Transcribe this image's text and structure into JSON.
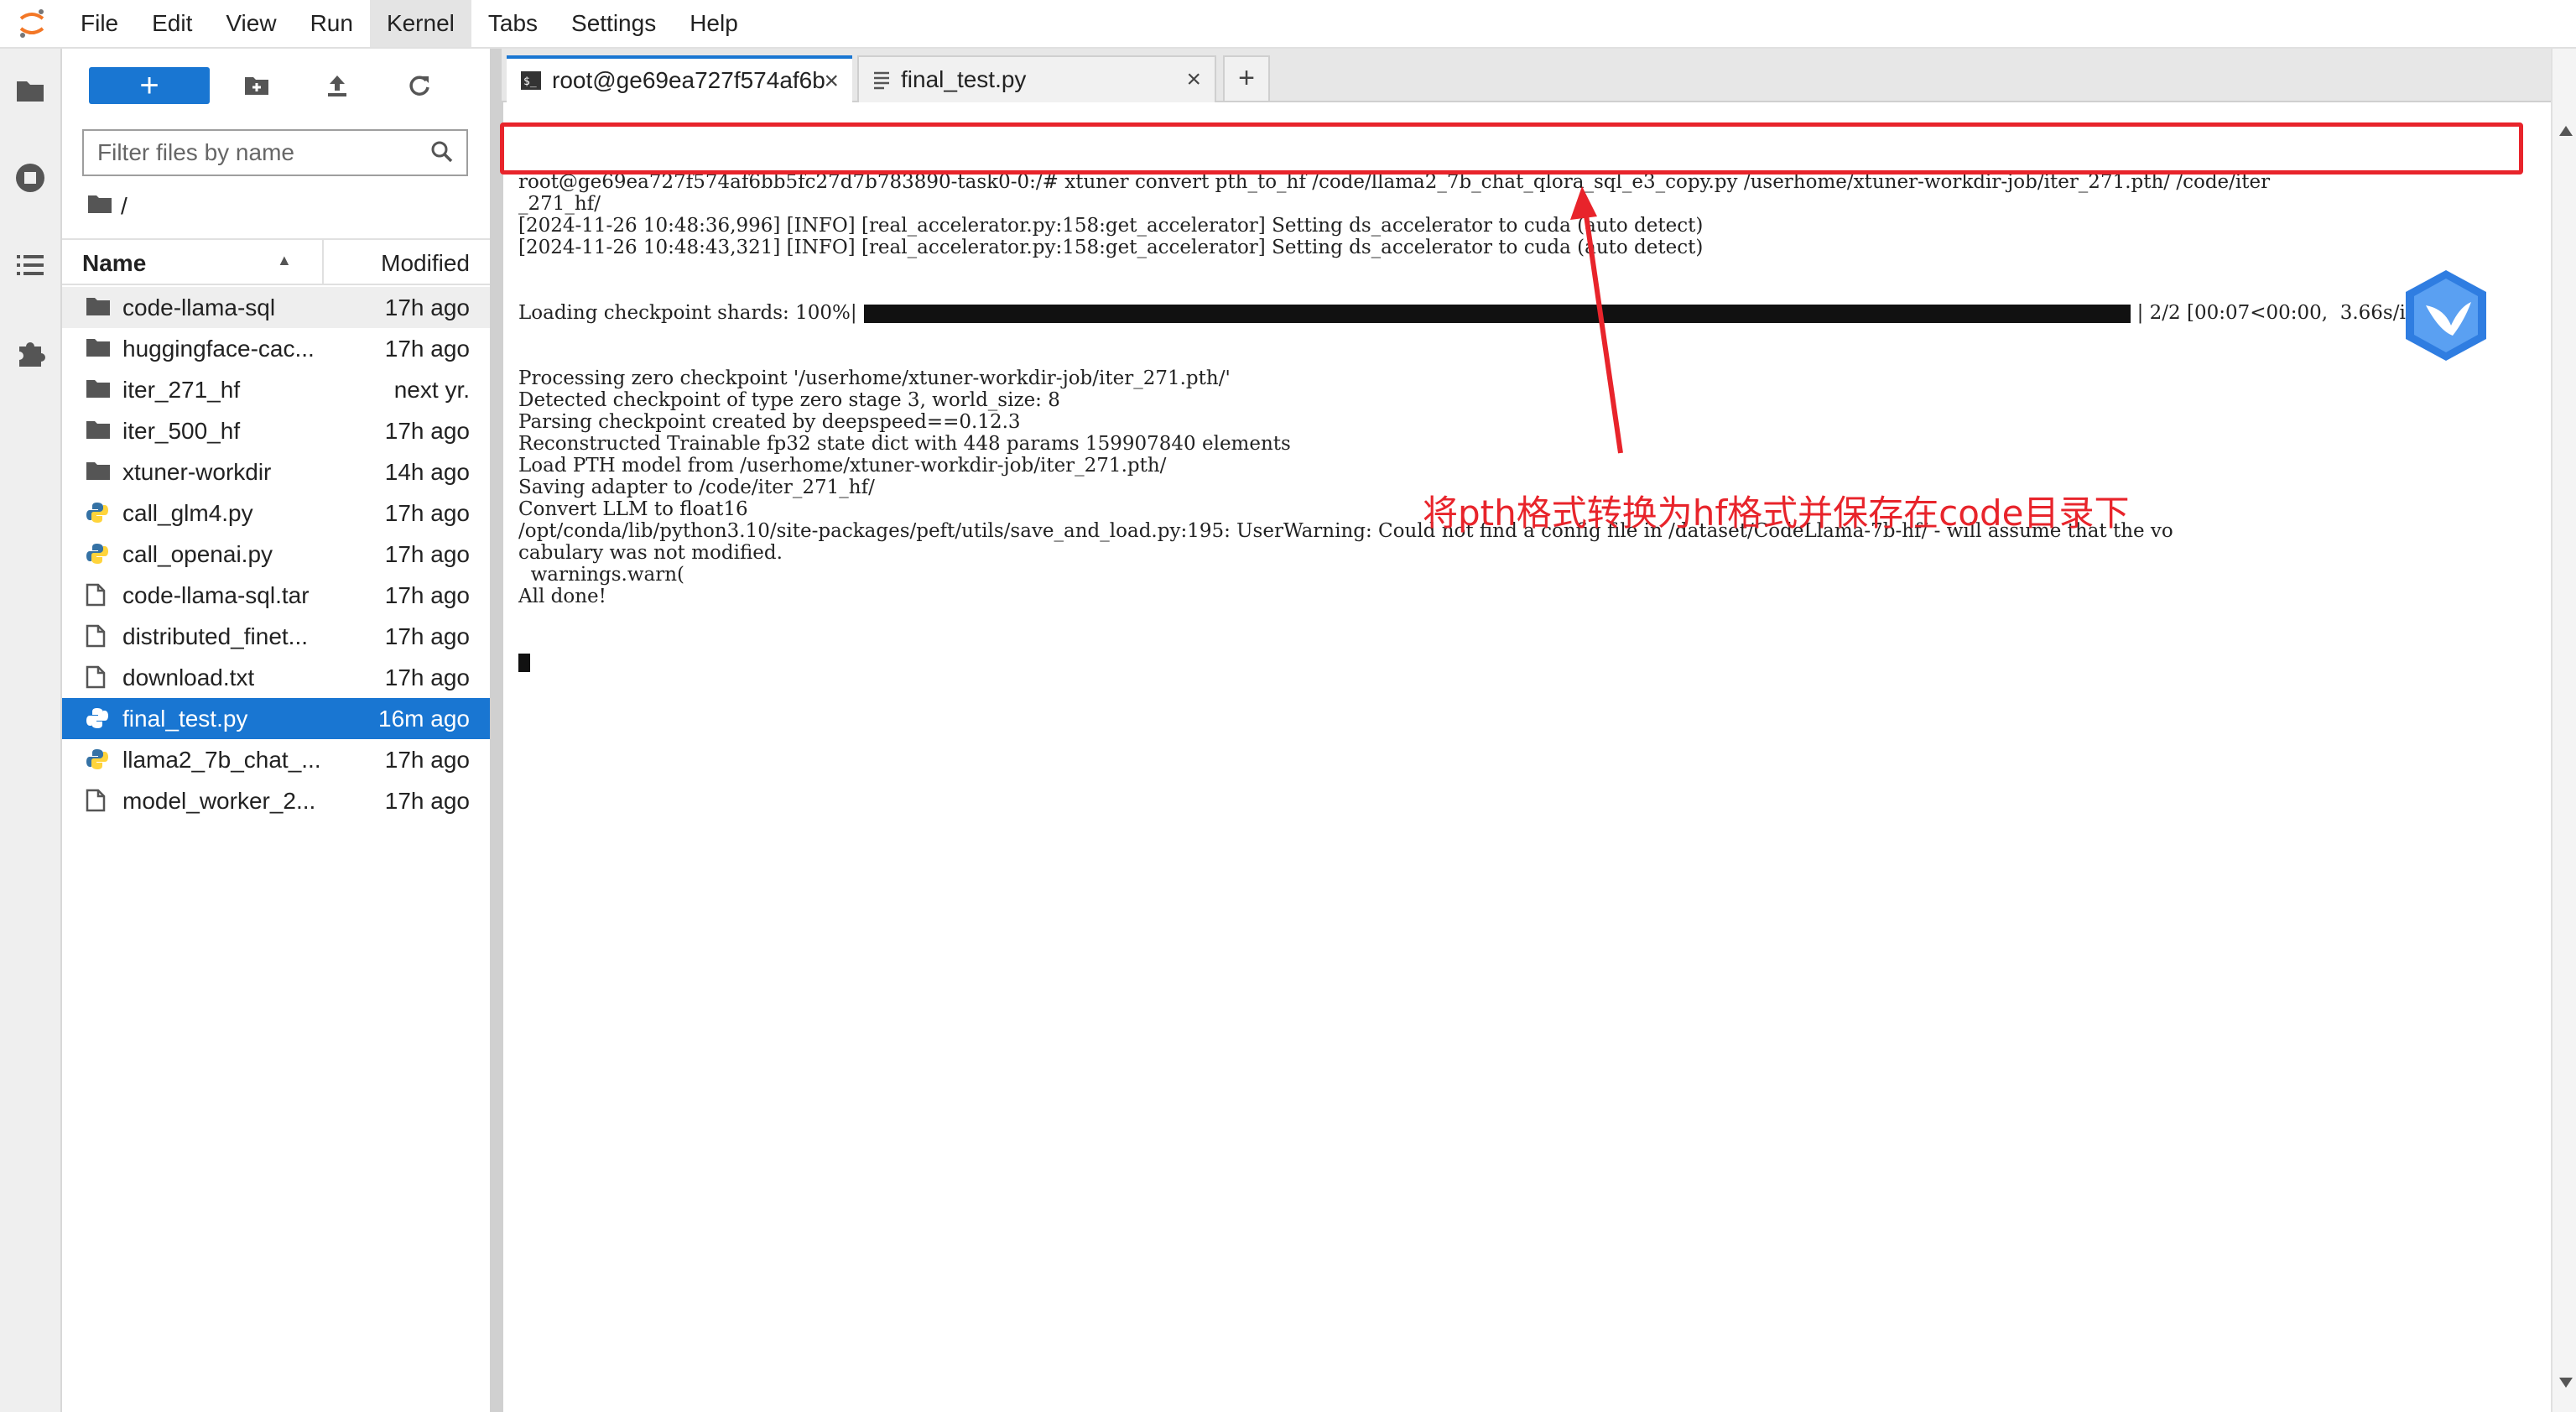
{
  "menubar": {
    "items": [
      "File",
      "Edit",
      "View",
      "Run",
      "Kernel",
      "Tabs",
      "Settings",
      "Help"
    ],
    "active": "Kernel"
  },
  "leftbar": {
    "icons": [
      "folder-icon",
      "running-icon",
      "toc-icon",
      "extension-icon"
    ]
  },
  "filebrowser": {
    "new_label": "+",
    "filter_placeholder": "Filter files by name",
    "breadcrumb": "/",
    "col_name": "Name",
    "col_modified": "Modified",
    "files": [
      {
        "name": "code-llama-sql",
        "modified": "17h ago",
        "type": "folder"
      },
      {
        "name": "huggingface-cac...",
        "modified": "17h ago",
        "type": "folder"
      },
      {
        "name": "iter_271_hf",
        "modified": "next yr.",
        "type": "folder"
      },
      {
        "name": "iter_500_hf",
        "modified": "17h ago",
        "type": "folder"
      },
      {
        "name": "xtuner-workdir",
        "modified": "14h ago",
        "type": "folder"
      },
      {
        "name": "call_glm4.py",
        "modified": "17h ago",
        "type": "python"
      },
      {
        "name": "call_openai.py",
        "modified": "17h ago",
        "type": "python"
      },
      {
        "name": "code-llama-sql.tar",
        "modified": "17h ago",
        "type": "file"
      },
      {
        "name": "distributed_finet...",
        "modified": "17h ago",
        "type": "file"
      },
      {
        "name": "download.txt",
        "modified": "17h ago",
        "type": "file"
      },
      {
        "name": "final_test.py",
        "modified": "16m ago",
        "type": "python"
      },
      {
        "name": "llama2_7b_chat_...",
        "modified": "17h ago",
        "type": "python"
      },
      {
        "name": "model_worker_2...",
        "modified": "17h ago",
        "type": "file"
      }
    ],
    "selected_index": 10
  },
  "tabs": [
    {
      "label": "root@ge69ea727f574af6b",
      "active": true
    },
    {
      "label": "final_test.py",
      "active": false
    }
  ],
  "terminal": {
    "lines": [
      "root@ge69ea727f574af6bb5fc27d7b783890-task0-0:/# xtuner convert pth_to_hf /code/llama2_7b_chat_qlora_sql_e3_copy.py /userhome/xtuner-workdir-job/iter_271.pth/ /code/iter",
      "_271_hf/",
      "[2024-11-26 10:48:36,996] [INFO] [real_accelerator.py:158:get_accelerator] Setting ds_accelerator to cuda (auto detect)",
      "[2024-11-26 10:48:43,321] [INFO] [real_accelerator.py:158:get_accelerator] Setting ds_accelerator to cuda (auto detect)"
    ],
    "progress_prefix": "Loading checkpoint shards: 100%|",
    "progress_suffix": "| 2/2 [00:07<00:00,  3.66s/it]",
    "lines_after": [
      "Processing zero checkpoint '/userhome/xtuner-workdir-job/iter_271.pth/'",
      "Detected checkpoint of type zero stage 3, world_size: 8",
      "Parsing checkpoint created by deepspeed==0.12.3",
      "Reconstructed Trainable fp32 state dict with 448 params 159907840 elements",
      "Load PTH model from /userhome/xtuner-workdir-job/iter_271.pth/",
      "Saving adapter to /code/iter_271_hf/",
      "Convert LLM to float16",
      "/opt/conda/lib/python3.10/site-packages/peft/utils/save_and_load.py:195: UserWarning: Could not find a config file in /dataset/CodeLlama-7b-hf/ - will assume that the vo",
      "cabulary was not modified.",
      "  warnings.warn(",
      "All done!"
    ]
  },
  "annotation": {
    "text": "将pth格式转换为hf格式并保存在code目录下",
    "color": "#e8242b"
  },
  "colors": {
    "accent": "#1976d2",
    "annotation_red": "#e8242b"
  }
}
